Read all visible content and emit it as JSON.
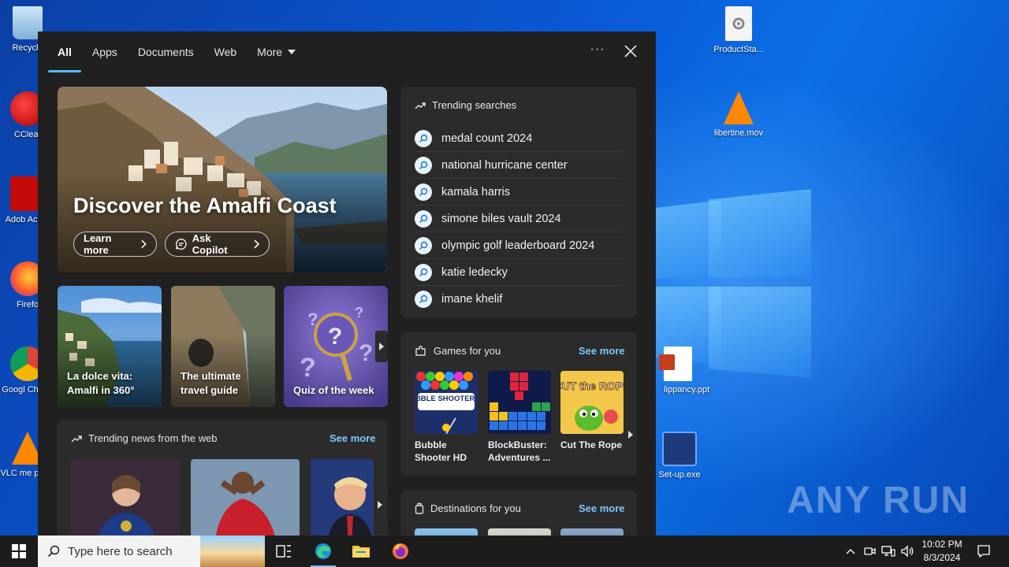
{
  "desktop": {
    "icons_left": [
      {
        "label": "Recycle"
      },
      {
        "label": "CClear"
      },
      {
        "label": "Adob Acrob"
      },
      {
        "label": "Firefo"
      },
      {
        "label": "Googl Chrom"
      },
      {
        "label": "VLC me playe"
      }
    ],
    "icons_right": [
      {
        "label": "ProductSta..."
      },
      {
        "label": "libertine.mov"
      },
      {
        "label": "lippancy.ppt"
      },
      {
        "label": "Set-up.exe"
      }
    ],
    "watermark": "ANY RUN"
  },
  "search_panel": {
    "tabs": [
      {
        "label": "All",
        "active": true
      },
      {
        "label": "Apps"
      },
      {
        "label": "Documents"
      },
      {
        "label": "Web"
      },
      {
        "label": "More"
      }
    ],
    "options_label": "···",
    "hero": {
      "title": "Discover the Amalfi Coast",
      "learn_more": "Learn more",
      "ask_copilot": "Ask Copilot"
    },
    "cards": [
      {
        "title": "La dolce vita: Amalfi in 360°"
      },
      {
        "title": "The ultimate travel guide"
      },
      {
        "title": "Quiz of the week"
      }
    ],
    "trending_news": {
      "title": "Trending news from the web",
      "see_more": "See more"
    },
    "trending_searches": {
      "title": "Trending searches",
      "items": [
        "medal count 2024",
        "national hurricane center",
        "kamala harris",
        "simone biles vault 2024",
        "olympic golf leaderboard 2024",
        "katie ledecky",
        "imane khelif"
      ]
    },
    "games": {
      "title": "Games for you",
      "see_more": "See more",
      "items": [
        {
          "name": "Bubble Shooter HD",
          "art_text": "BUBBLE SHOOTER HD"
        },
        {
          "name": "BlockBuster: Adventures ..."
        },
        {
          "name": "Cut The Rope",
          "art_text": "CUT the ROPE"
        }
      ]
    },
    "destinations": {
      "title": "Destinations for you",
      "see_more": "See more"
    }
  },
  "taskbar": {
    "search_placeholder": "Type here to search",
    "time": "10:02 PM",
    "date": "8/3/2024"
  },
  "colors": {
    "accent": "#4cc2ff",
    "link": "#7fc6ff",
    "panel_bg": "#202020",
    "card_bg": "#2b2b2b",
    "taskbar_bg": "#1c1c1c"
  }
}
